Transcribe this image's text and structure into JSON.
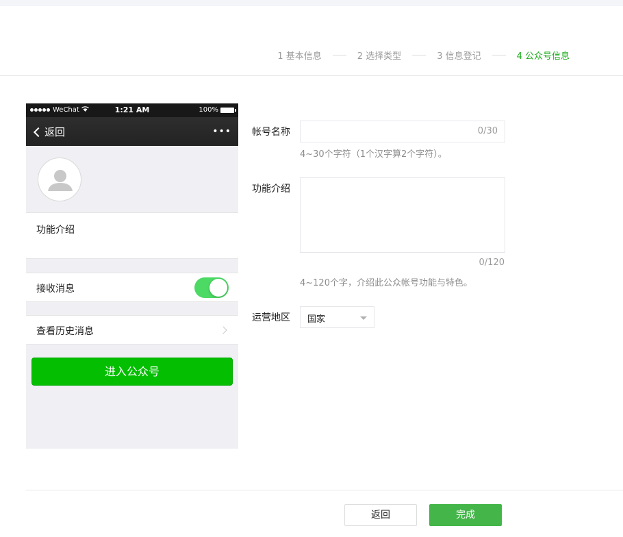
{
  "steps": [
    {
      "label": "1 基本信息",
      "active": false
    },
    {
      "label": "2 选择类型",
      "active": false
    },
    {
      "label": "3 信息登记",
      "active": false
    },
    {
      "label": "4 公众号信息",
      "active": true
    }
  ],
  "phone": {
    "carrier": "WeChat",
    "time": "1:21 AM",
    "battery": "100%",
    "back_label": "返回",
    "more": "•••",
    "intro_label": "功能介绍",
    "receive_label": "接收消息",
    "receive_on": true,
    "history_label": "查看历史消息",
    "enter_button": "进入公众号"
  },
  "form": {
    "name_label": "帐号名称",
    "name_counter": "0/30",
    "name_hint": "4~30个字符（1个汉字算2个字符）。",
    "intro_label": "功能介绍",
    "intro_counter": "0/120",
    "intro_hint": "4~120个字，介绍此公众帐号功能与特色。",
    "region_label": "运营地区",
    "region_value": "国家"
  },
  "footer": {
    "back_button": "返回",
    "done_button": "完成"
  },
  "colors": {
    "accent_green": "#1aad19",
    "done_button": "#44b549",
    "enter_button": "#04be02",
    "toggle_on": "#4cd964"
  }
}
